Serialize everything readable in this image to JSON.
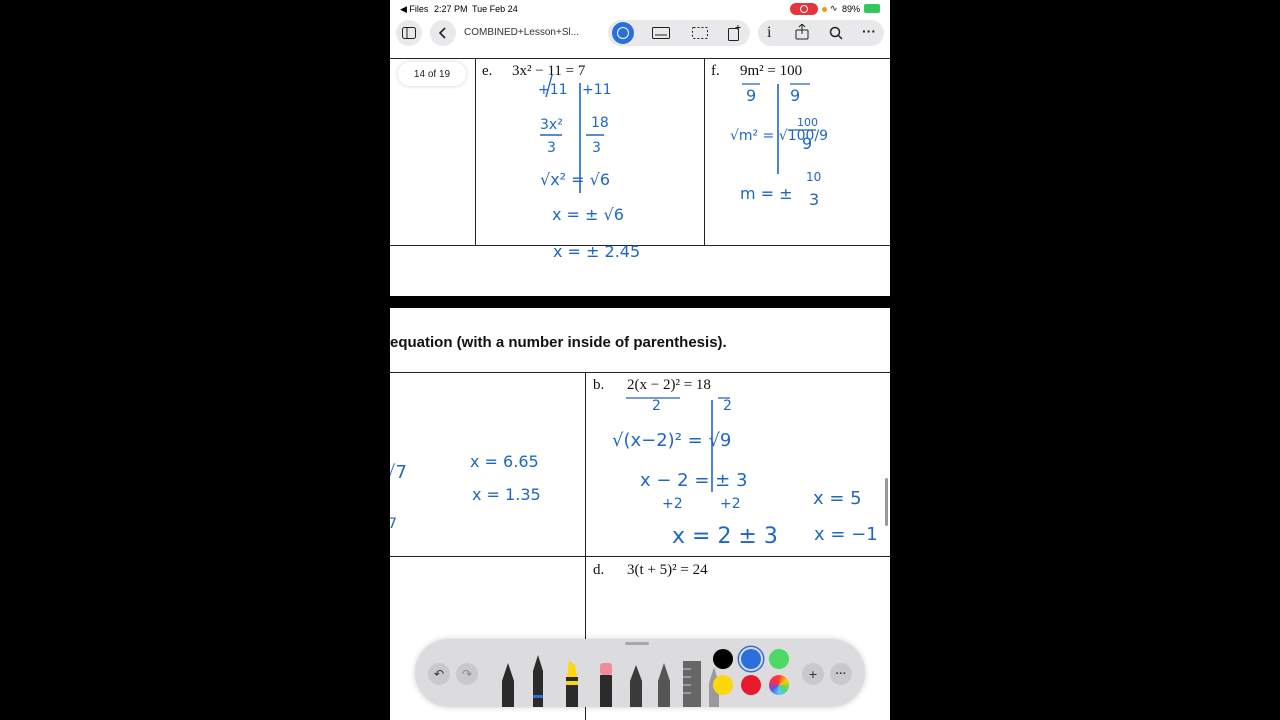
{
  "status_bar": {
    "back_app": "◀ Files",
    "time": "2:27 PM",
    "date": "Tue Feb 24",
    "battery": "89%"
  },
  "toolbar": {
    "document_title": "COMBINED+Lesson+Sl...",
    "page_indicator": "14 of 19"
  },
  "worksheet": {
    "top": {
      "e": {
        "label": "e.",
        "equation": "3x² − 11 = 7",
        "work": [
          "+11",
          "+11",
          "3x²",
          "3",
          "18",
          "3",
          "√x² = √6",
          "x = ± √6",
          "x = ± 2.45"
        ]
      },
      "f": {
        "label": "f.",
        "equation": "9m² = 100",
        "work": [
          "9",
          "9",
          "√m² = √100/9",
          "100",
          "9",
          "m = ±",
          "10",
          "3"
        ]
      }
    },
    "section_heading": "equation (with a number inside of parenthesis).",
    "left_work": [
      "√7",
      "x = 6.65",
      "x = 1.35",
      "7"
    ],
    "b": {
      "label": "b.",
      "equation": "2(x − 2)² = 18",
      "work": [
        "2",
        "2",
        "√(x−2)² = √9",
        "x − 2 = ± 3",
        "+2",
        "+2",
        "x = 2 ± 3",
        "x = 5",
        "x = −1"
      ]
    },
    "d": {
      "label": "d.",
      "equation": "3(t + 5)² = 24"
    }
  },
  "pen_colors": [
    "#000000",
    "#2a6fdb",
    "#4cd964",
    "#ffd60a",
    "#e8192c",
    "rainbow"
  ],
  "icons": {
    "record": "record-icon",
    "wifi": "wifi-icon",
    "battery": "battery-icon"
  }
}
